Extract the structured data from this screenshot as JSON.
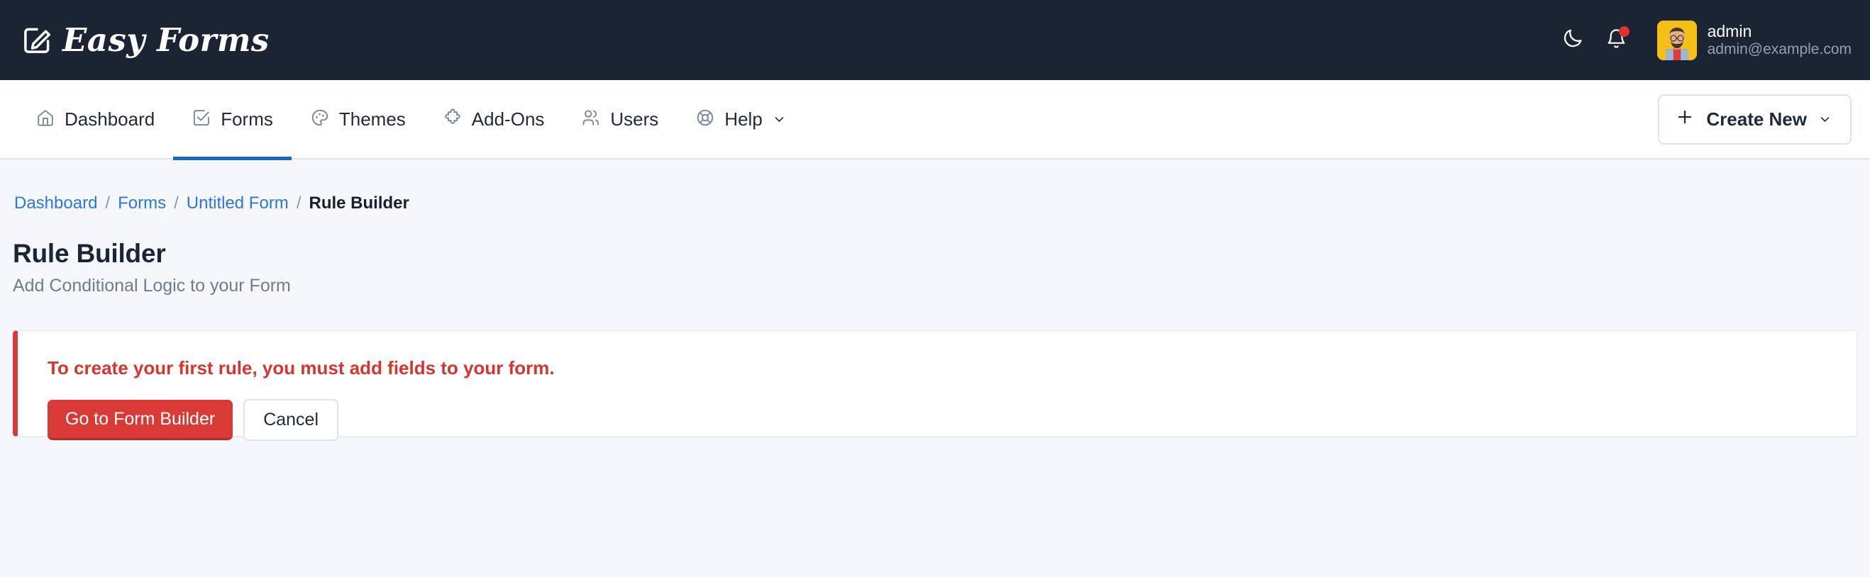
{
  "brand": {
    "name": "Easy Forms",
    "icon": "pencil-square-icon"
  },
  "topbar": {
    "dark_mode_icon": "moon-icon",
    "notifications_icon": "bell-icon",
    "user": {
      "name": "admin",
      "email": "admin@example.com",
      "avatar": "user-avatar-photo"
    }
  },
  "nav": {
    "items": [
      {
        "label": "Dashboard",
        "icon": "home-icon",
        "active": false
      },
      {
        "label": "Forms",
        "icon": "checkbox-square-icon",
        "active": true
      },
      {
        "label": "Themes",
        "icon": "palette-icon",
        "active": false
      },
      {
        "label": "Add-Ons",
        "icon": "puzzle-piece-icon",
        "active": false
      },
      {
        "label": "Users",
        "icon": "users-icon",
        "active": false
      },
      {
        "label": "Help",
        "icon": "lifebuoy-icon",
        "active": false,
        "caret": true
      }
    ],
    "create_button": {
      "label": "Create New",
      "plus_icon": "plus-icon",
      "caret_icon": "chevron-down-icon"
    }
  },
  "breadcrumb": {
    "items": [
      "Dashboard",
      "Forms",
      "Untitled Form"
    ],
    "current": "Rule Builder",
    "separator": "/"
  },
  "page": {
    "title": "Rule Builder",
    "subtitle": "Add Conditional Logic to your Form"
  },
  "alert": {
    "message": "To create your first rule, you must add fields to your form.",
    "primary_button": "Go to Form Builder",
    "secondary_button": "Cancel"
  },
  "colors": {
    "header_bg": "#1b2432",
    "page_bg": "#f6f7fb",
    "accent_blue": "#1c66bd",
    "link_blue": "#2c77dd",
    "danger_red": "#d93a36",
    "avatar_bg": "#f5bf16",
    "notification_dot": "#e03131"
  }
}
